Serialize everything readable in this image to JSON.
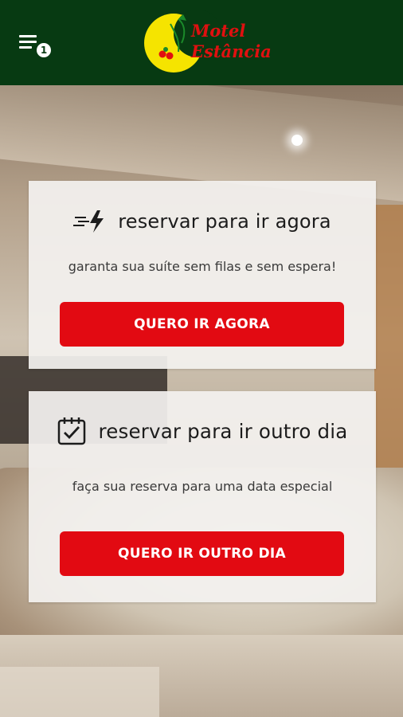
{
  "header": {
    "notification_count": "1",
    "logo_line1": "Motel",
    "logo_line2": "Estância",
    "bar_color": "#073a12",
    "logo_text_color": "#e01010",
    "logo_moon_color": "#f5e400"
  },
  "cards": [
    {
      "icon": "lightning-speed-icon",
      "title": "reservar para ir agora",
      "subtitle": "garanta sua suíte sem filas e sem espera!",
      "button_label": "QUERO IR AGORA"
    },
    {
      "icon": "calendar-check-icon",
      "title": "reservar para ir outro dia",
      "subtitle": "faça sua reserva para uma data especial",
      "button_label": "QUERO IR OUTRO DIA"
    }
  ],
  "colors": {
    "button": "#e20a12",
    "card_background": "#f3f1ef"
  }
}
